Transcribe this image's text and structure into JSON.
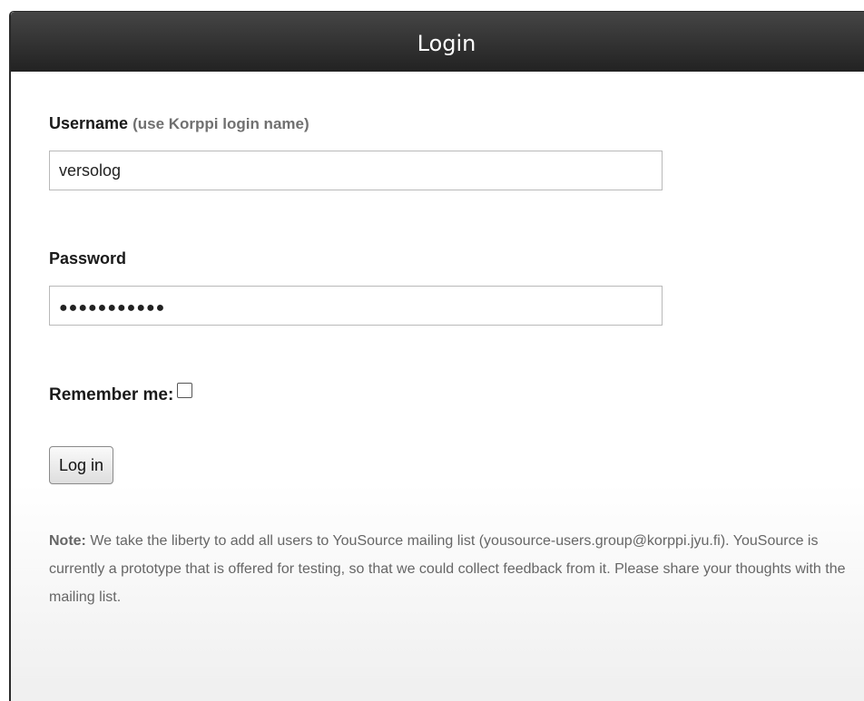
{
  "dialog": {
    "title": "Login"
  },
  "form": {
    "username_label": "Username",
    "username_hint": "(use Korppi login name)",
    "username_value": "versolog",
    "password_label": "Password",
    "password_mask": "●●●●●●●●●●●",
    "remember_label": "Remember me:",
    "remember_checked": false,
    "login_button": "Log in"
  },
  "note": {
    "label": "Note:",
    "text": " We take the liberty to add all users to YouSource mailing list (yousource-users.group@korppi.jyu.fi). YouSource is currently a prototype that is offered for testing, so that we could collect feedback from it. Please share your thoughts with the mailing list."
  }
}
